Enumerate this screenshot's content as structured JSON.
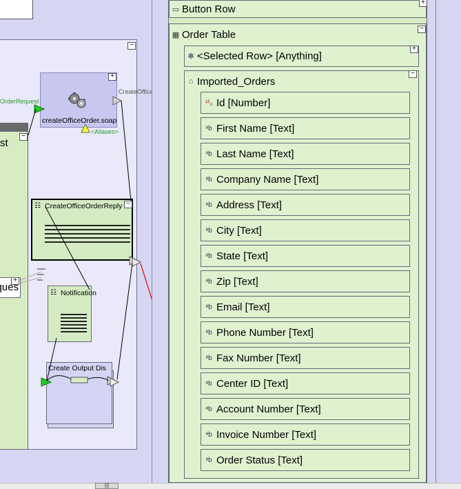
{
  "left": {
    "green_panel_label": "st",
    "ques_label": "ques",
    "soap": {
      "label": "createOfficeOrder.soap",
      "in_port": "OrderRequest",
      "out_port": "CreateOfficeOrderReply",
      "aliases": "<Aliases>"
    },
    "reply": {
      "label": "CreateOfficeOrderReply"
    },
    "notif": {
      "label": "Notification"
    },
    "output": {
      "label": "Create Output Dis"
    },
    "scroll_thumb": "|||"
  },
  "tree": {
    "button_row": "Button Row",
    "order_table": "Order Table",
    "selected_row": "<Selected Row> [Anything]",
    "imported_orders": "Imported_Orders",
    "fields": [
      {
        "label": "Id [Number]",
        "icon": "number-icon"
      },
      {
        "label": "First Name [Text]",
        "icon": "text-icon"
      },
      {
        "label": "Last Name [Text]",
        "icon": "text-icon"
      },
      {
        "label": "Company Name [Text]",
        "icon": "text-icon"
      },
      {
        "label": "Address [Text]",
        "icon": "text-icon"
      },
      {
        "label": "City [Text]",
        "icon": "text-icon"
      },
      {
        "label": "State [Text]",
        "icon": "text-icon"
      },
      {
        "label": "Zip [Text]",
        "icon": "text-icon"
      },
      {
        "label": "Email [Text]",
        "icon": "text-icon"
      },
      {
        "label": "Phone Number [Text]",
        "icon": "text-icon"
      },
      {
        "label": "Fax Number [Text]",
        "icon": "text-icon"
      },
      {
        "label": "Center ID [Text]",
        "icon": "text-icon"
      },
      {
        "label": "Account Number [Text]",
        "icon": "text-icon"
      },
      {
        "label": "Invoice Number [Text]",
        "icon": "text-icon"
      },
      {
        "label": "Order Status [Text]",
        "icon": "text-icon"
      }
    ]
  },
  "colors": {
    "canvas": "#d6d6f3",
    "node_green": "#d8ecc4",
    "link_red": "#e00000",
    "port_green": "#22cc22",
    "port_label_green": "#2a9a2a"
  }
}
